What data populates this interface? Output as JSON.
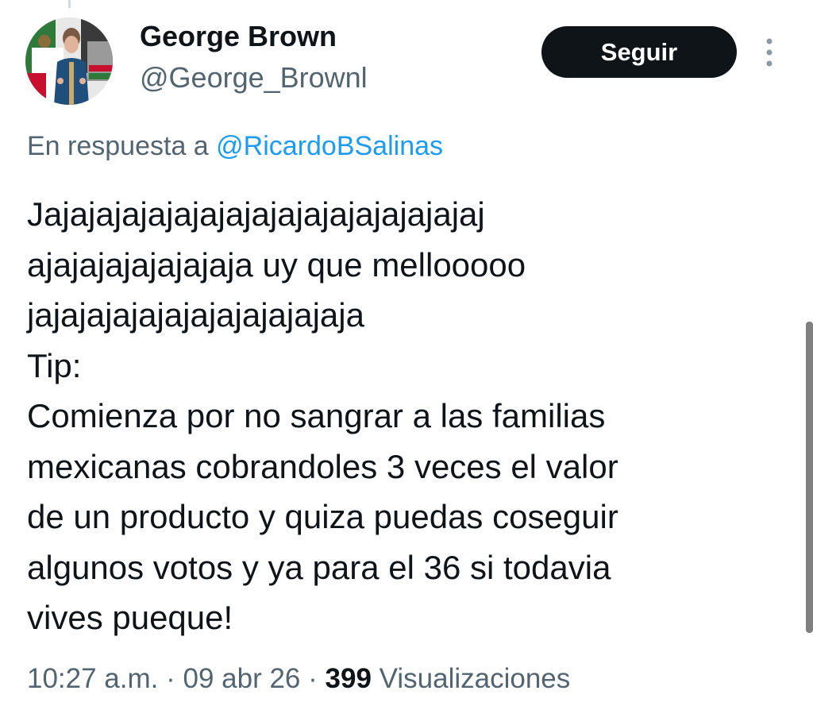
{
  "author": {
    "name": "George Brown",
    "handle": "@George_Brownl"
  },
  "follow_button": {
    "label": "Seguir"
  },
  "more_icon": "vertical-ellipsis",
  "reply": {
    "prefix": "En respuesta a ",
    "mention": "@RicardoBSalinas"
  },
  "tweet": {
    "text": "Jajajajajajajajajajajajajajajajajaj\najajajajajajajaja uy que mellooooo\njajajajajajajajajajajajaja\nTip:\nComienza por no sangrar a las familias\nmexicanas cobrandoles 3 veces el valor\nde un producto y quiza puedas coseguir\nalgunos votos y ya para el 36 si todavia\nvives pueque!"
  },
  "meta": {
    "time": "10:27 a.m.",
    "sep1": " · ",
    "date": "09 abr 26",
    "sep2": " · ",
    "views_count": "399",
    "views_label": " Visualizaciones"
  },
  "colors": {
    "text": "#0f1419",
    "secondary": "#536471",
    "link": "#1d9bf0",
    "button_bg": "#0f1419"
  }
}
